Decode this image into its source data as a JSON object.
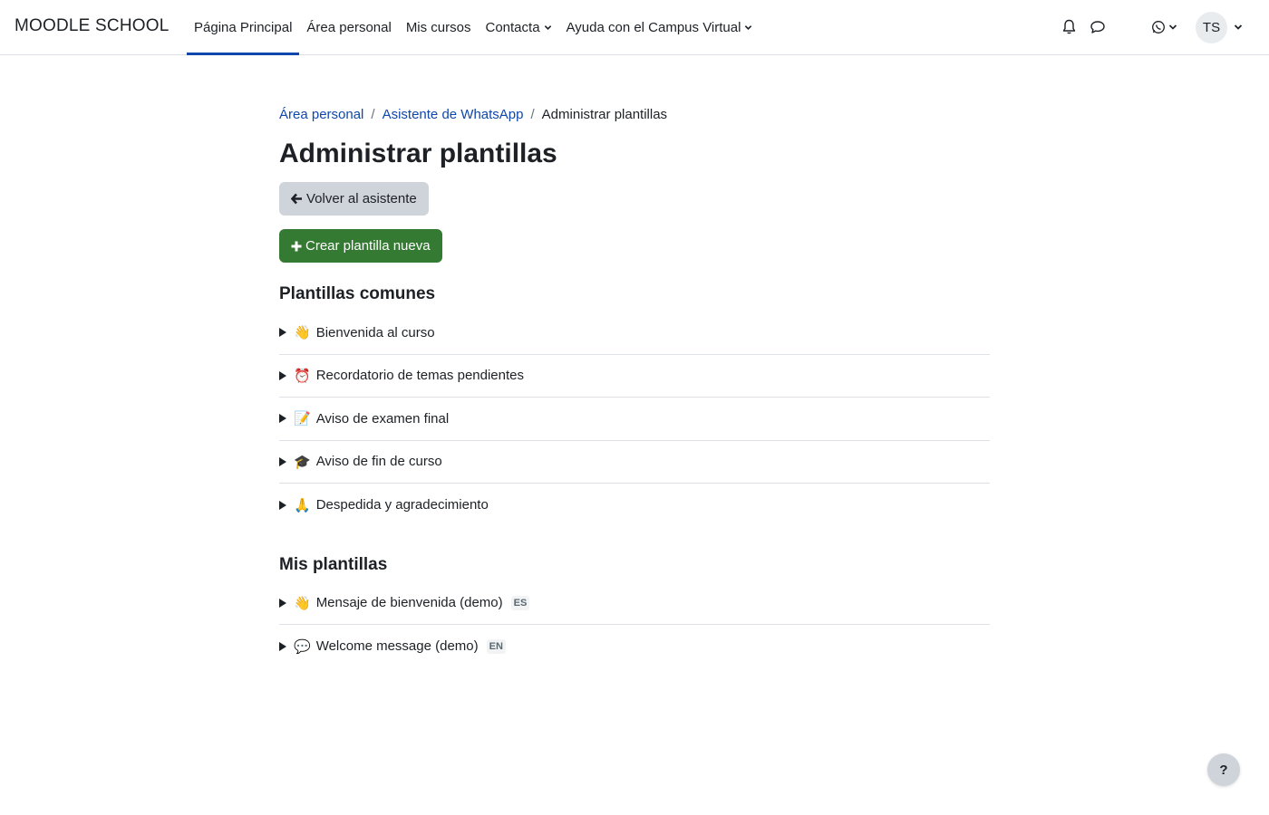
{
  "navbar": {
    "brand": "MOODLE SCHOOL",
    "items": [
      {
        "label": "Página Principal",
        "active": true,
        "dropdown": false
      },
      {
        "label": "Área personal",
        "active": false,
        "dropdown": false
      },
      {
        "label": "Mis cursos",
        "active": false,
        "dropdown": false
      },
      {
        "label": "Contacta",
        "active": false,
        "dropdown": true
      },
      {
        "label": "Ayuda con el Campus Virtual",
        "active": false,
        "dropdown": true
      }
    ],
    "icons": [
      "bell-icon",
      "chat-bubble-icon",
      "whatsapp-icon"
    ],
    "user_initials": "TS"
  },
  "breadcrumb": {
    "items": [
      "Área personal",
      "Asistente de WhatsApp"
    ],
    "current": "Administrar plantillas"
  },
  "page_title": "Administrar plantillas",
  "buttons": {
    "back_label": "Volver al asistente",
    "create_label": "Crear plantilla nueva"
  },
  "common_templates": {
    "heading": "Plantillas comunes",
    "items": [
      {
        "emoji": "👋",
        "label": "Bienvenida al curso"
      },
      {
        "emoji": "⏰",
        "label": "Recordatorio de temas pendientes"
      },
      {
        "emoji": "📝",
        "label": "Aviso de examen final"
      },
      {
        "emoji": "🎓",
        "label": "Aviso de fin de curso"
      },
      {
        "emoji": "🙏",
        "label": "Despedida y agradecimiento"
      }
    ]
  },
  "my_templates": {
    "heading": "Mis plantillas",
    "items": [
      {
        "emoji": "👋",
        "label": "Mensaje de bienvenida (demo)",
        "lang": "ES"
      },
      {
        "emoji": "💬",
        "label": "Welcome message (demo)",
        "lang": "EN"
      }
    ]
  },
  "help": {
    "label": "?"
  },
  "colors": {
    "link": "#0f47ad",
    "success": "#357a32",
    "secondary": "#ced4da"
  }
}
